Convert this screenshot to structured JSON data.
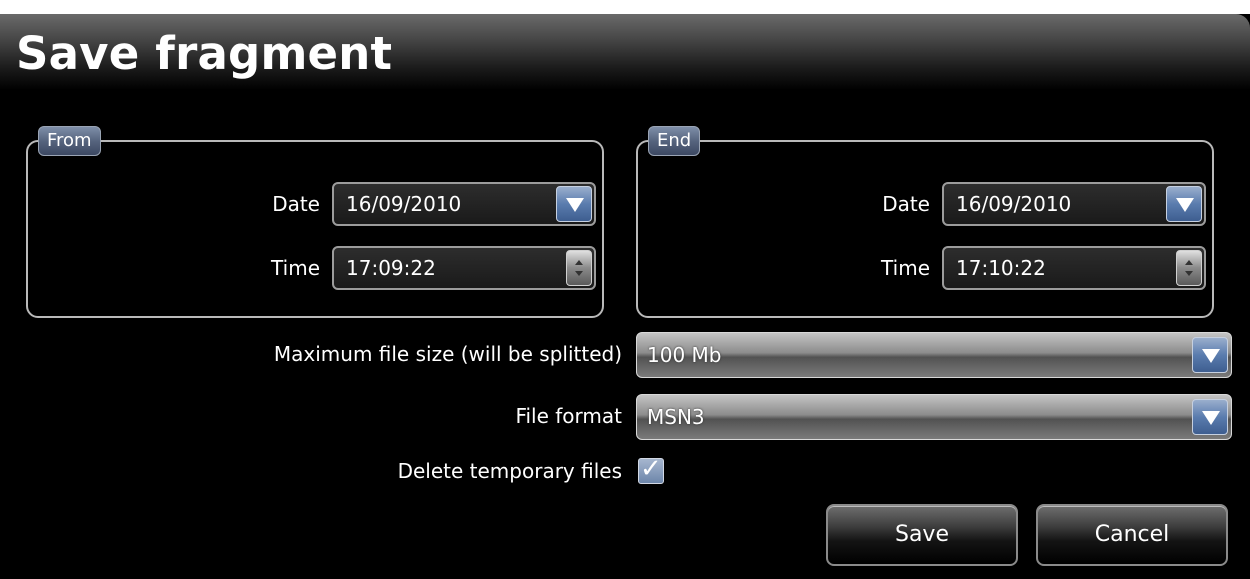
{
  "window": {
    "title": "Save fragment"
  },
  "from": {
    "legend": "From",
    "date_label": "Date",
    "date_value": "16/09/2010",
    "time_label": "Time",
    "time_value": "17:09:22"
  },
  "end": {
    "legend": "End",
    "date_label": "Date",
    "date_value": "16/09/2010",
    "time_label": "Time",
    "time_value": "17:10:22"
  },
  "max_size": {
    "label": "Maximum file size (will be splitted)",
    "value": "100 Mb"
  },
  "file_format": {
    "label": "File format",
    "value": "MSN3"
  },
  "delete_temp": {
    "label": "Delete temporary files",
    "checked": true,
    "check_glyph": "✓"
  },
  "buttons": {
    "save": "Save",
    "cancel": "Cancel"
  },
  "colors": {
    "background": "#000000",
    "accent": "#5a7cae",
    "border": "#b9b9b9"
  }
}
